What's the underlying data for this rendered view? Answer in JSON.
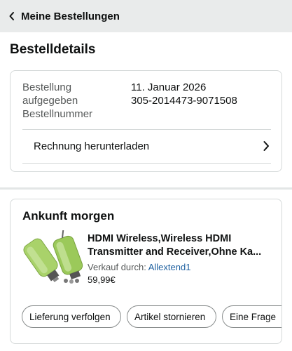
{
  "header": {
    "back_label": "Meine Bestellungen"
  },
  "page": {
    "title": "Bestelldetails"
  },
  "order": {
    "label_ordered": "Bestellung",
    "label_ordered_2": "aufgegeben",
    "label_number": "Bestellnummer",
    "date": "11. Januar 2026",
    "number": "305-2014473-9071508",
    "invoice_label": "Rechnung herunterladen"
  },
  "shipment": {
    "status": "Ankunft morgen",
    "product_title_line1": "HDMI Wireless,Wireless HDMI",
    "product_title_line2": "Transmitter and Receiver,Ohne Ka...",
    "seller_prefix": "Verkauf durch:",
    "seller_name": "Allextend1",
    "price": "59,99€",
    "actions": [
      "Lieferung verfolgen",
      "Artikel stornieren",
      "Eine Frage"
    ]
  },
  "colors": {
    "link": "#2162a1",
    "header_bg": "#e9ebeb",
    "product_green": "#9bc95a"
  },
  "icons": {
    "back": "chevron-left-icon",
    "invoice": "chevron-right-icon"
  }
}
